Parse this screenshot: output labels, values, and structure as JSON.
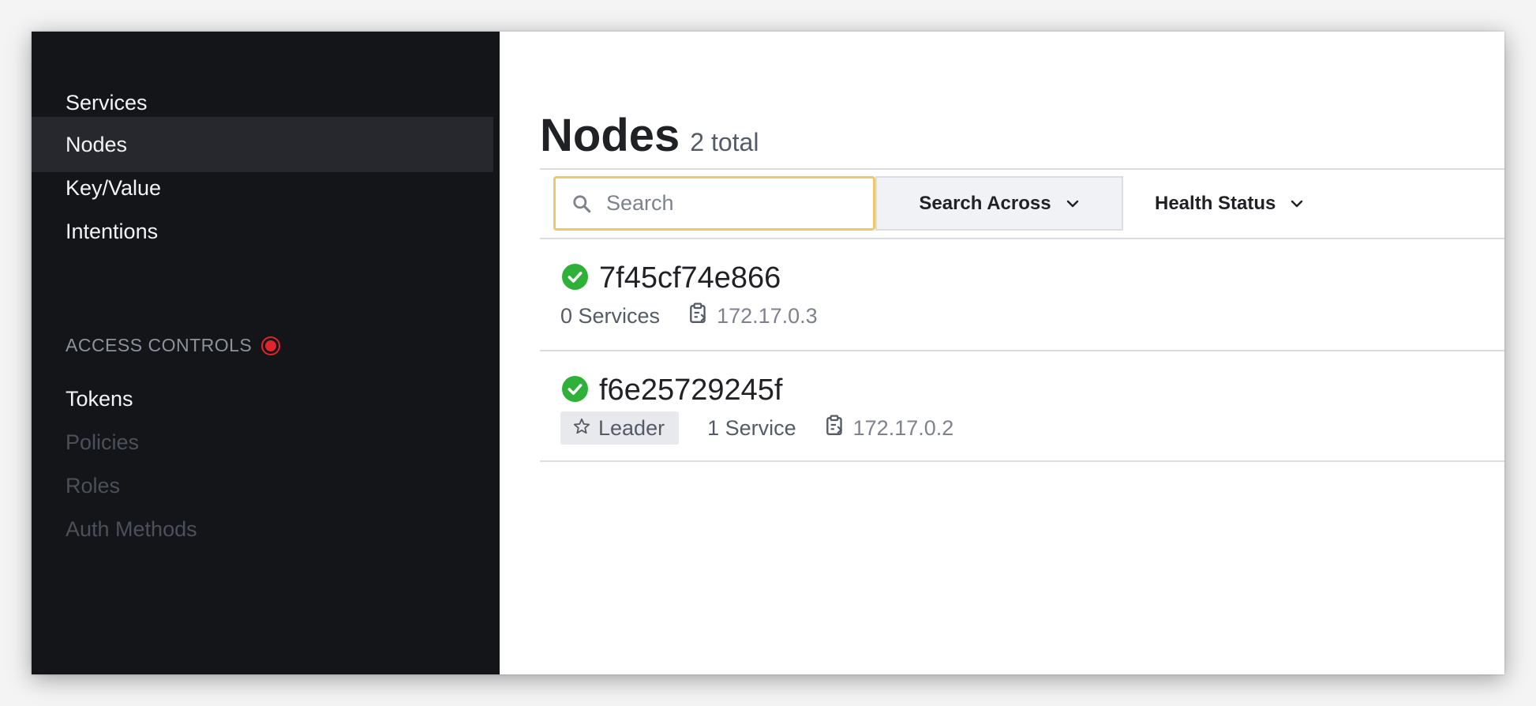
{
  "sidebar": {
    "items": [
      {
        "label": "Services"
      },
      {
        "label": "Nodes"
      },
      {
        "label": "Key/Value"
      },
      {
        "label": "Intentions"
      }
    ],
    "access_controls": {
      "heading": "ACCESS CONTROLS",
      "items": [
        {
          "label": "Tokens"
        },
        {
          "label": "Policies"
        },
        {
          "label": "Roles"
        },
        {
          "label": "Auth Methods"
        }
      ]
    }
  },
  "header": {
    "title": "Nodes",
    "count": "2 total"
  },
  "filters": {
    "search_placeholder": "Search",
    "search_value": "",
    "search_across_label": "Search Across",
    "health_status_label": "Health Status"
  },
  "nodes": [
    {
      "name": "7f45cf74e866",
      "services": "0 Services",
      "address": "172.17.0.3",
      "leader": false
    },
    {
      "name": "f6e25729245f",
      "leader_label": "Leader",
      "services": "1 Service",
      "address": "172.17.0.2",
      "leader": true
    }
  ],
  "colors": {
    "sidebar_bg": "#131519",
    "sidebar_active": "#27282d",
    "passing": "#2eb039",
    "search_focus": "#efc86a",
    "alert": "#e0252f"
  }
}
